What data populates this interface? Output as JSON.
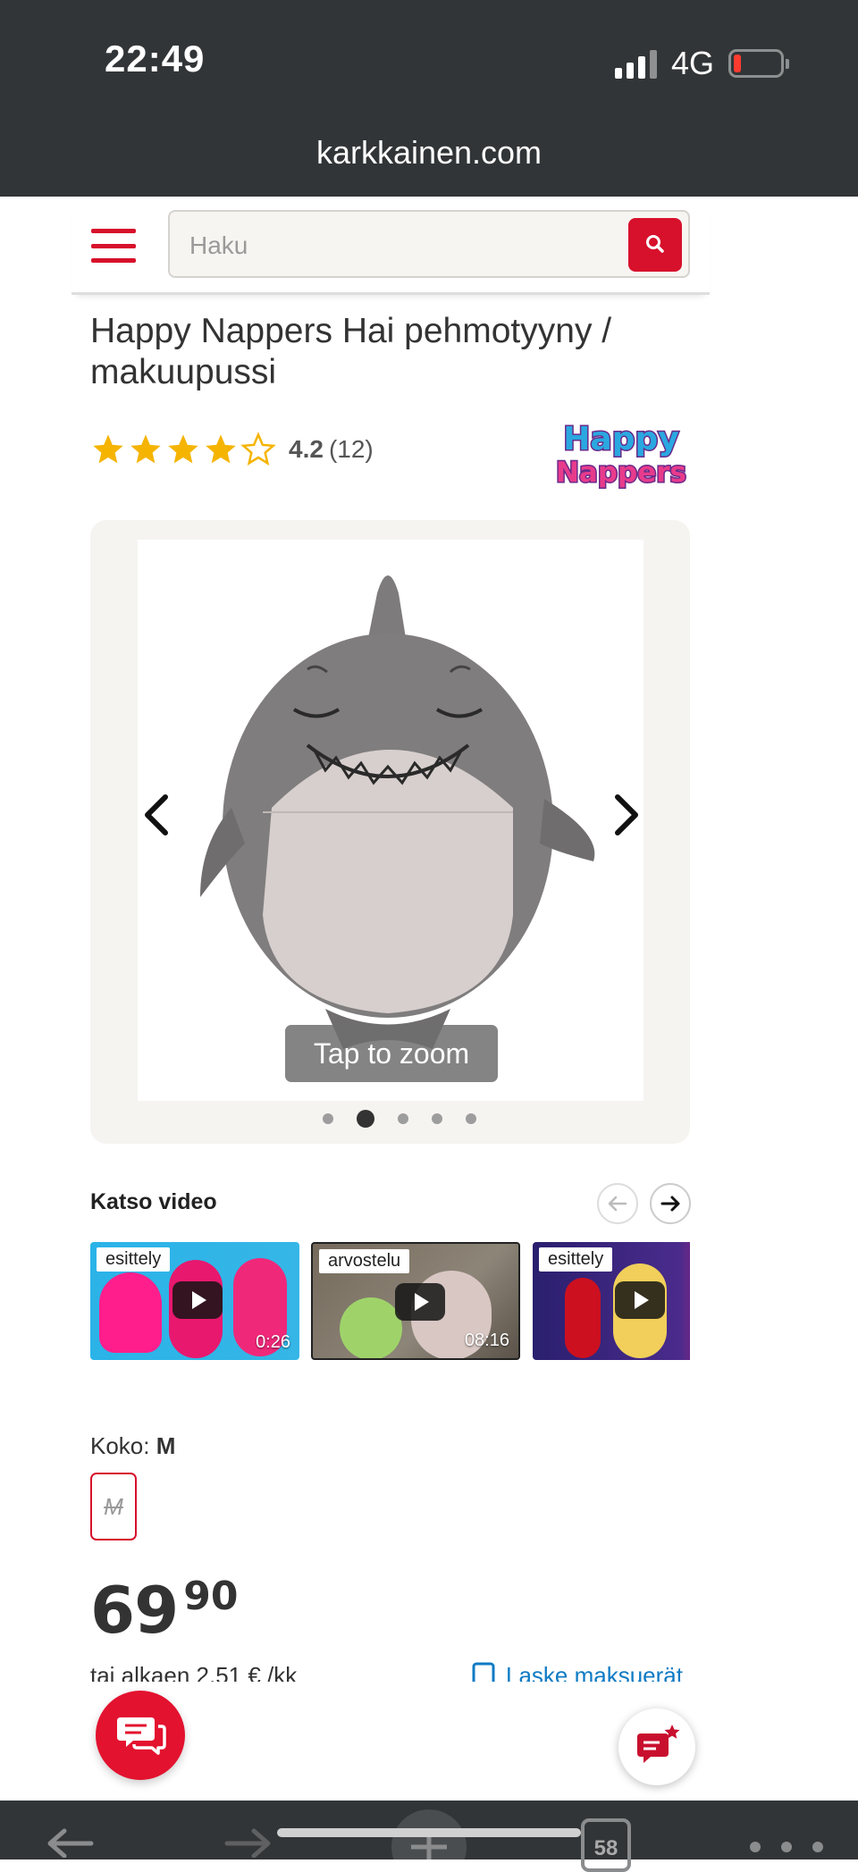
{
  "status_bar": {
    "time": "22:49",
    "network": "4G",
    "url": "karkkainen.com"
  },
  "search": {
    "placeholder": "Haku"
  },
  "product": {
    "title": "Happy Nappers Hai pehmotyyny / makuupussi",
    "rating_value": "4.2",
    "rating_count": "(12)",
    "stars": 4.2,
    "brand": "Happy Nappers"
  },
  "gallery": {
    "zoom_label": "Tap to zoom",
    "dot_count": 5,
    "active_dot": 2
  },
  "videos": {
    "title": "Katso video",
    "items": [
      {
        "tag": "esittely",
        "duration": "0:26"
      },
      {
        "tag": "arvostelu",
        "duration": "08:16"
      },
      {
        "tag": "esittely",
        "duration": ""
      }
    ]
  },
  "size": {
    "label": "Koko: ",
    "selected": "M",
    "option": "M"
  },
  "price": {
    "euros": "69",
    "cents": "90",
    "installment": "tai alkaen 2,51 € /kk",
    "calc_link": "Laske maksuerät"
  },
  "toolbar": {
    "tabs_count": "58"
  },
  "colors": {
    "brand_red": "#d7102b",
    "status_bar": "#323537",
    "star": "#f5b400"
  }
}
